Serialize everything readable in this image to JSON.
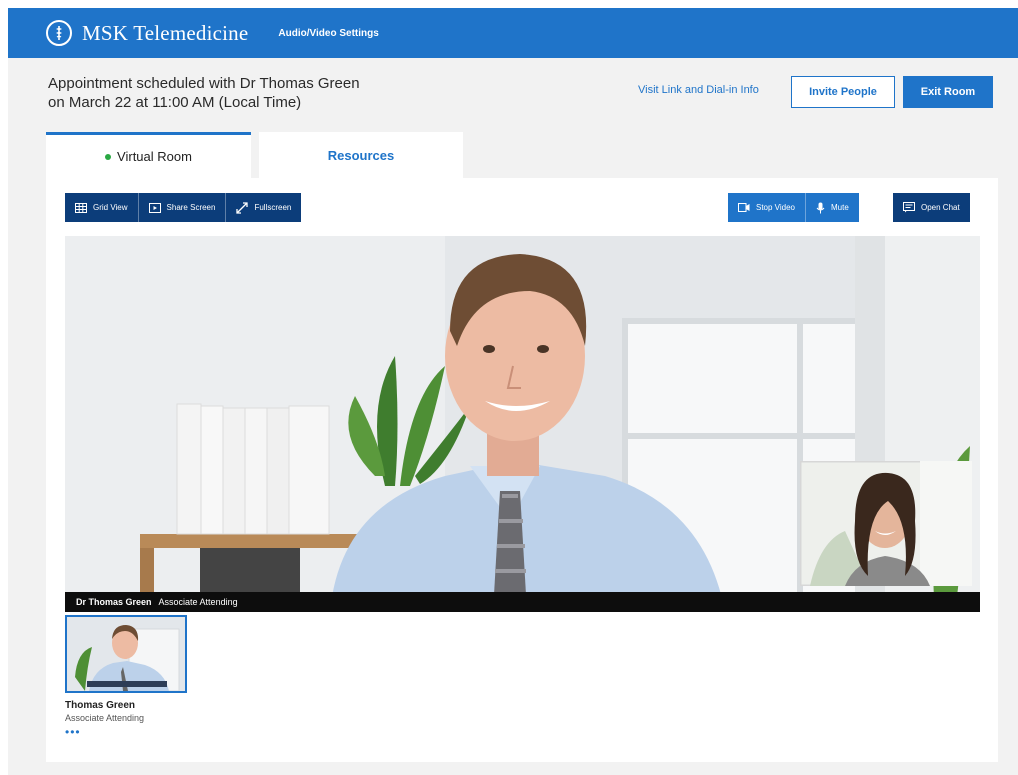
{
  "header": {
    "brand": "MSK Telemedicine",
    "settings_link": "Audio/Video Settings"
  },
  "appointment": {
    "line1": "Appointment scheduled with Dr Thomas Green",
    "line2": "on March 22 at 11:00 AM (Local Time)"
  },
  "actions": {
    "visit_link": "Visit Link and Dial-in Info",
    "invite": "Invite People",
    "exit": "Exit Room"
  },
  "tabs": [
    {
      "label": "Virtual Room",
      "active": true
    },
    {
      "label": "Resources",
      "active": false
    }
  ],
  "toolbar": {
    "grid_view": "Grid View",
    "share_screen": "Share Screen",
    "fullscreen": "Fullscreen",
    "stop_video": "Stop Video",
    "mute": "Mute",
    "open_chat": "Open Chat"
  },
  "main_video": {
    "participant_name": "Dr Thomas Green",
    "participant_role": "Associate Attending"
  },
  "thumbnail": {
    "name": "Thomas Green",
    "role": "Associate Attending",
    "more": "•••"
  },
  "colors": {
    "brand_blue": "#1f74c9",
    "toolbar_dark": "#0c3d7a",
    "active_dot": "#2aa843"
  }
}
